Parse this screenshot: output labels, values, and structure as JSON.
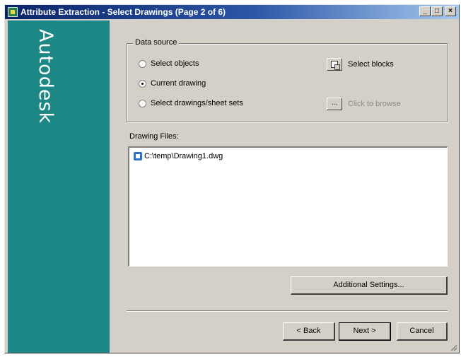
{
  "window": {
    "title": "Attribute Extraction - Select Drawings (Page 2 of 6)",
    "controls": {
      "minimize": "_",
      "maximize": "□",
      "close": "×"
    }
  },
  "sidebar": {
    "brand": "Autodesk",
    "color": "#1c8784"
  },
  "data_source": {
    "legend": "Data source",
    "options": [
      {
        "label": "Select objects",
        "selected": false
      },
      {
        "label": "Current drawing",
        "selected": true
      },
      {
        "label": "Select drawings/sheet sets",
        "selected": false
      }
    ],
    "select_blocks_label": "Select blocks",
    "browse_button_label": "...",
    "browse_label": "Click to browse"
  },
  "drawing_files": {
    "label": "Drawing Files:",
    "items": [
      {
        "path": "C:\\temp\\Drawing1.dwg",
        "icon": "drawing-file-icon"
      }
    ]
  },
  "buttons": {
    "additional_settings": "Additional Settings...",
    "back": "< Back",
    "next": "Next >",
    "cancel": "Cancel"
  }
}
